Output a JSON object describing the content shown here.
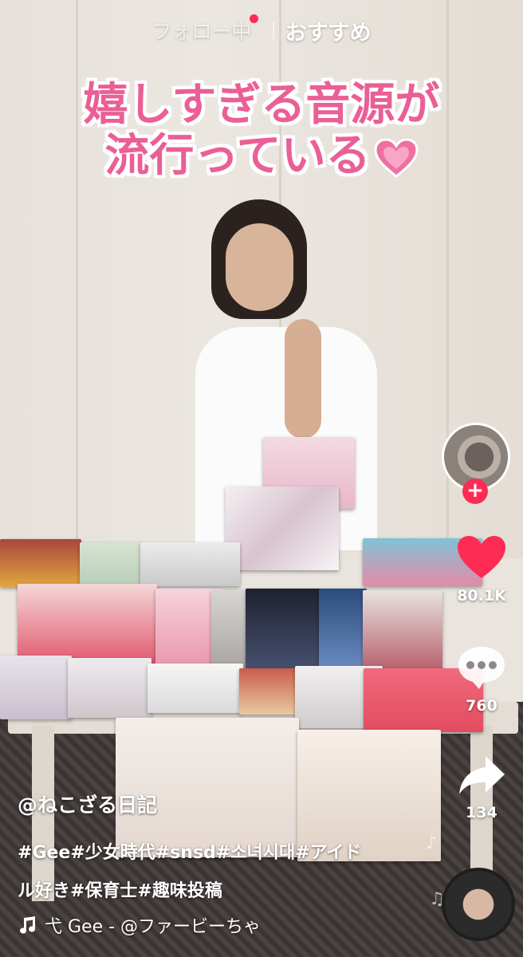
{
  "tabs": {
    "following": "フォロー中",
    "for_you": "おすすめ"
  },
  "caption": {
    "line1": "嬉しすぎる音源が",
    "line2": "流行っている"
  },
  "actions": {
    "likes": "80.1K",
    "comments": "760",
    "shares": "134"
  },
  "post": {
    "username": "@ねこざる日記",
    "description_line1": "#Gee#少女時代#snsd#소녀시대#アイド",
    "description_line2": "ル好き#保育士#趣味投稿",
    "music": "弋 Gee - @ファービーちゃ"
  },
  "colors": {
    "accent": "#fe2c55",
    "like": "#fe2c55",
    "caption": "#ea5f95"
  },
  "icons": {
    "follow": "plus-icon",
    "like": "heart-icon",
    "comment": "comment-icon",
    "share": "share-icon",
    "music": "music-note-icon"
  }
}
